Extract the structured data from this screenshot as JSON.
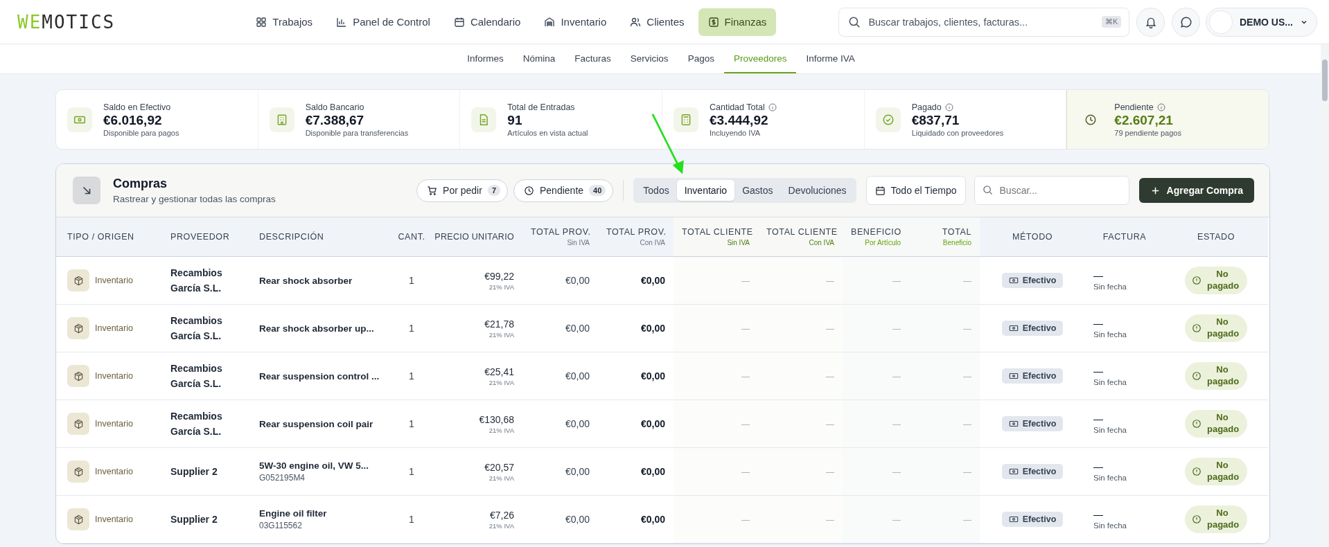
{
  "logo": {
    "accent": "WE",
    "rest": "MOTICS"
  },
  "nav": [
    {
      "label": "Trabajos",
      "selected": false
    },
    {
      "label": "Panel de Control",
      "selected": false
    },
    {
      "label": "Calendario",
      "selected": false
    },
    {
      "label": "Inventario",
      "selected": false
    },
    {
      "label": "Clientes",
      "selected": false
    },
    {
      "label": "Finanzas",
      "selected": true
    }
  ],
  "search": {
    "placeholder": "Buscar trabajos, clientes, facturas...",
    "shortcut": "⌘K"
  },
  "user": {
    "name": "DEMO US..."
  },
  "subnav": [
    {
      "label": "Informes",
      "selected": false
    },
    {
      "label": "Nómina",
      "selected": false
    },
    {
      "label": "Facturas",
      "selected": false
    },
    {
      "label": "Servicios",
      "selected": false
    },
    {
      "label": "Pagos",
      "selected": false
    },
    {
      "label": "Proveedores",
      "selected": true
    },
    {
      "label": "Informe IVA",
      "selected": false
    }
  ],
  "stats": [
    {
      "label": "Saldo en Efectivo",
      "info": false,
      "value": "€6.016,92",
      "note": "Disponible para pagos",
      "highlight": false
    },
    {
      "label": "Saldo Bancario",
      "info": false,
      "value": "€7.388,67",
      "note": "Disponible para transferencias",
      "highlight": false
    },
    {
      "label": "Total de Entradas",
      "info": false,
      "value": "91",
      "note": "Artículos en vista actual",
      "highlight": false
    },
    {
      "label": "Cantidad Total",
      "info": true,
      "value": "€3.444,92",
      "note": "Incluyendo IVA",
      "highlight": false
    },
    {
      "label": "Pagado",
      "info": true,
      "value": "€837,71",
      "note": "Liquidado con proveedores",
      "highlight": false
    },
    {
      "label": "Pendiente",
      "info": true,
      "value": "€2.607,21",
      "note": "79 pendiente pagos",
      "highlight": true
    }
  ],
  "annotation": {
    "kind": "arrow"
  },
  "purchases": {
    "title": "Compras",
    "subtitle": "Rastrear y gestionar todas las compras",
    "pills": [
      {
        "label": "Por pedir",
        "count": "7"
      },
      {
        "label": "Pendiente",
        "count": "40"
      }
    ],
    "segments": [
      {
        "label": "Todos",
        "selected": false
      },
      {
        "label": "Inventario",
        "selected": true
      },
      {
        "label": "Gastos",
        "selected": false
      },
      {
        "label": "Devoluciones",
        "selected": false
      }
    ],
    "period": "Todo el Tiempo",
    "search_placeholder": "Buscar...",
    "add_button": "Agregar Compra"
  },
  "table": {
    "columns": [
      {
        "label": "TIPO / ORIGEN"
      },
      {
        "label": "PROVEEDOR"
      },
      {
        "label": "DESCRIPCIÓN"
      },
      {
        "label": "CANT."
      },
      {
        "label": "PRECIO UNITARIO"
      },
      {
        "label": "TOTAL PROV.",
        "sub": "Sin IVA"
      },
      {
        "label": "TOTAL PROV.",
        "sub": "Con IVA"
      },
      {
        "label": "TOTAL CLIENTE",
        "sub": "Sin IVA"
      },
      {
        "label": "TOTAL CLIENTE",
        "sub": "Con IVA"
      },
      {
        "label": "BENEFICIO",
        "sub": "Por Artículo"
      },
      {
        "label": "TOTAL",
        "sub": "Beneficio"
      },
      {
        "label": "MÉTODO"
      },
      {
        "label": "FACTURA"
      },
      {
        "label": "ESTADO"
      }
    ],
    "rows": [
      {
        "type": "Inventario",
        "supplier": "Recambios García S.L.",
        "description": "Rear shock absorber",
        "qty": "1",
        "price": "€99,22",
        "vat": "21% IVA",
        "prov_net": "€0,00",
        "prov_gross": "€0,00",
        "client_net": "—",
        "client_gross": "—",
        "profit_item": "—",
        "profit_total": "—",
        "method": "Efectivo",
        "invoice": "—",
        "invoice_date": "Sin fecha",
        "status": "No pagado"
      },
      {
        "type": "Inventario",
        "supplier": "Recambios García S.L.",
        "description": "Rear shock absorber up...",
        "qty": "1",
        "price": "€21,78",
        "vat": "21% IVA",
        "prov_net": "€0,00",
        "prov_gross": "€0,00",
        "client_net": "—",
        "client_gross": "—",
        "profit_item": "—",
        "profit_total": "—",
        "method": "Efectivo",
        "invoice": "—",
        "invoice_date": "Sin fecha",
        "status": "No pagado"
      },
      {
        "type": "Inventario",
        "supplier": "Recambios García S.L.",
        "description": "Rear suspension control ...",
        "qty": "1",
        "price": "€25,41",
        "vat": "21% IVA",
        "prov_net": "€0,00",
        "prov_gross": "€0,00",
        "client_net": "—",
        "client_gross": "—",
        "profit_item": "—",
        "profit_total": "—",
        "method": "Efectivo",
        "invoice": "—",
        "invoice_date": "Sin fecha",
        "status": "No pagado"
      },
      {
        "type": "Inventario",
        "supplier": "Recambios García S.L.",
        "description": "Rear suspension coil pair",
        "qty": "1",
        "price": "€130,68",
        "vat": "21% IVA",
        "prov_net": "€0,00",
        "prov_gross": "€0,00",
        "client_net": "—",
        "client_gross": "—",
        "profit_item": "—",
        "profit_total": "—",
        "method": "Efectivo",
        "invoice": "—",
        "invoice_date": "Sin fecha",
        "status": "No pagado"
      },
      {
        "type": "Inventario",
        "supplier": "Supplier 2",
        "description": "5W-30 engine oil, VW 5...",
        "code": "G052195M4",
        "qty": "1",
        "price": "€20,57",
        "vat": "21% IVA",
        "prov_net": "€0,00",
        "prov_gross": "€0,00",
        "client_net": "—",
        "client_gross": "—",
        "profit_item": "—",
        "profit_total": "—",
        "method": "Efectivo",
        "invoice": "—",
        "invoice_date": "Sin fecha",
        "status": "No pagado"
      },
      {
        "type": "Inventario",
        "supplier": "Supplier 2",
        "description": "Engine oil filter",
        "code": "03G115562",
        "qty": "1",
        "price": "€7,26",
        "vat": "21% IVA",
        "prov_net": "€0,00",
        "prov_gross": "€0,00",
        "client_net": "—",
        "client_gross": "—",
        "profit_item": "—",
        "profit_total": "—",
        "method": "Efectivo",
        "invoice": "—",
        "invoice_date": "Sin fecha",
        "status": "No pagado"
      }
    ]
  }
}
